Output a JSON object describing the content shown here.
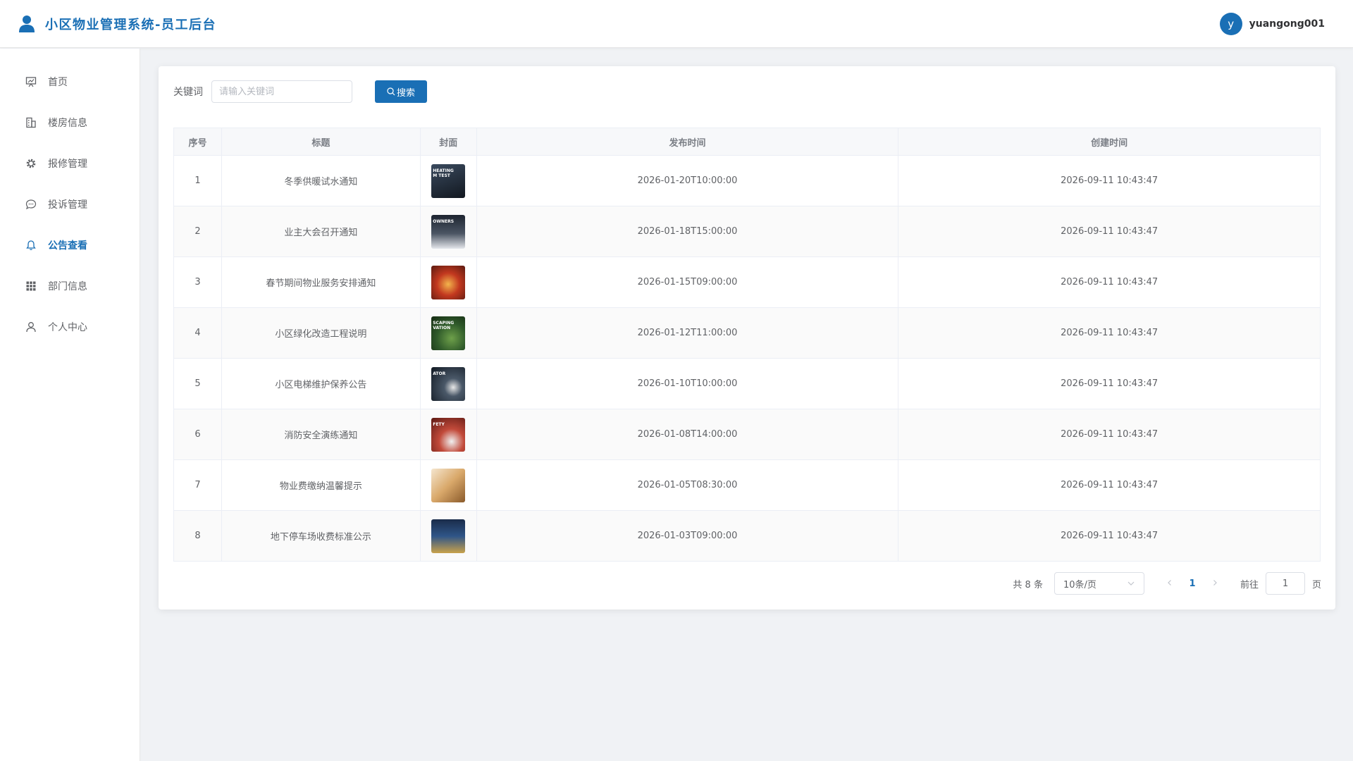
{
  "header": {
    "title": "小区物业管理系统-员工后台",
    "avatar_letter": "y",
    "username": "yuangong001"
  },
  "sidebar": {
    "items": [
      {
        "label": "首页",
        "icon": "presentation-icon"
      },
      {
        "label": "楼房信息",
        "icon": "building-icon"
      },
      {
        "label": "报修管理",
        "icon": "gear-icon"
      },
      {
        "label": "投诉管理",
        "icon": "chat-icon"
      },
      {
        "label": "公告查看",
        "icon": "bell-icon",
        "active": true
      },
      {
        "label": "部门信息",
        "icon": "grid-icon"
      },
      {
        "label": "个人中心",
        "icon": "user-icon"
      }
    ]
  },
  "search": {
    "label": "关键词",
    "placeholder": "请输入关键词",
    "button_label": "搜索"
  },
  "table": {
    "headers": [
      "序号",
      "标题",
      "封面",
      "发布时间",
      "创建时间"
    ],
    "rows": [
      {
        "index": "1",
        "title": "冬季供暖试水通知",
        "publish_time": "2026-01-20T10:00:00",
        "create_time": "2026-09-11 10:43:47",
        "cover_text": "HEATING\nM TEST",
        "cover_color": "#1e2a38"
      },
      {
        "index": "2",
        "title": "业主大会召开通知",
        "publish_time": "2026-01-18T15:00:00",
        "create_time": "2026-09-11 10:43:47",
        "cover_text": "OWNERS",
        "cover_color": "#2b3440"
      },
      {
        "index": "3",
        "title": "春节期间物业服务安排通知",
        "publish_time": "2026-01-15T09:00:00",
        "create_time": "2026-09-11 10:43:47",
        "cover_text": "",
        "cover_color": "#a8321e"
      },
      {
        "index": "4",
        "title": "小区绿化改造工程说明",
        "publish_time": "2026-01-12T11:00:00",
        "create_time": "2026-09-11 10:43:47",
        "cover_text": "SCAPING\nVATION",
        "cover_color": "#2f5a2a"
      },
      {
        "index": "5",
        "title": "小区电梯维护保养公告",
        "publish_time": "2026-01-10T10:00:00",
        "create_time": "2026-09-11 10:43:47",
        "cover_text": "ATOR",
        "cover_color": "#1d2b3a"
      },
      {
        "index": "6",
        "title": "消防安全演练通知",
        "publish_time": "2026-01-08T14:00:00",
        "create_time": "2026-09-11 10:43:47",
        "cover_text": "FETY",
        "cover_color": "#8e2a24"
      },
      {
        "index": "7",
        "title": "物业费缴纳温馨提示",
        "publish_time": "2026-01-05T08:30:00",
        "create_time": "2026-09-11 10:43:47",
        "cover_text": "",
        "cover_color": "#c99b62"
      },
      {
        "index": "8",
        "title": "地下停车场收费标准公示",
        "publish_time": "2026-01-03T09:00:00",
        "create_time": "2026-09-11 10:43:47",
        "cover_text": "",
        "cover_color": "#23406a"
      }
    ]
  },
  "pagination": {
    "total": "共 8 条",
    "page_size": "10条/页",
    "current_page": "1",
    "goto_label": "前往",
    "goto_value": "1",
    "goto_suffix": "页"
  },
  "colors": {
    "accent": "#1a6fb5",
    "background": "#f0f2f5"
  }
}
